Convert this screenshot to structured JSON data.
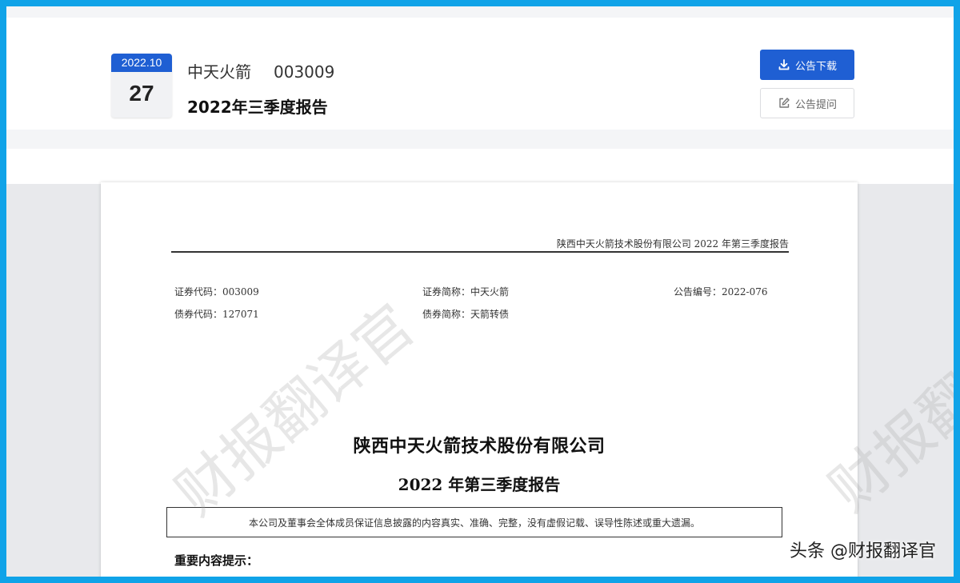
{
  "header": {
    "date_year_month": "2022.10",
    "date_day": "27",
    "company_name": "中天火箭",
    "stock_code": "003009",
    "report_title": "2022年三季度报告",
    "download_label": "公告下载",
    "question_label": "公告提问",
    "accent_color": "#1f5fd3"
  },
  "document": {
    "running_head": "陕西中天火箭技术股份有限公司 2022 年第三季度报告",
    "meta": {
      "securities_code": "证券代码：003009",
      "securities_abbr": "证券简称：中天火箭",
      "announcement_no": "公告编号：2022-076",
      "bond_code": "债券代码：127071",
      "bond_abbr": "债券简称：天箭转债"
    },
    "company_full_name": "陕西中天火箭技术股份有限公司",
    "report_heading": "2022 年第三季度报告",
    "statement": "本公司及董事会全体成员保证信息披露的内容真实、准确、完整，没有虚假记载、误导性陈述或重大遗漏。",
    "section_heading": "重要内容提示："
  },
  "watermark": {
    "text_left": "财报翻译官",
    "text_right": "财报翻"
  },
  "attribution": "头条 @财报翻译官"
}
